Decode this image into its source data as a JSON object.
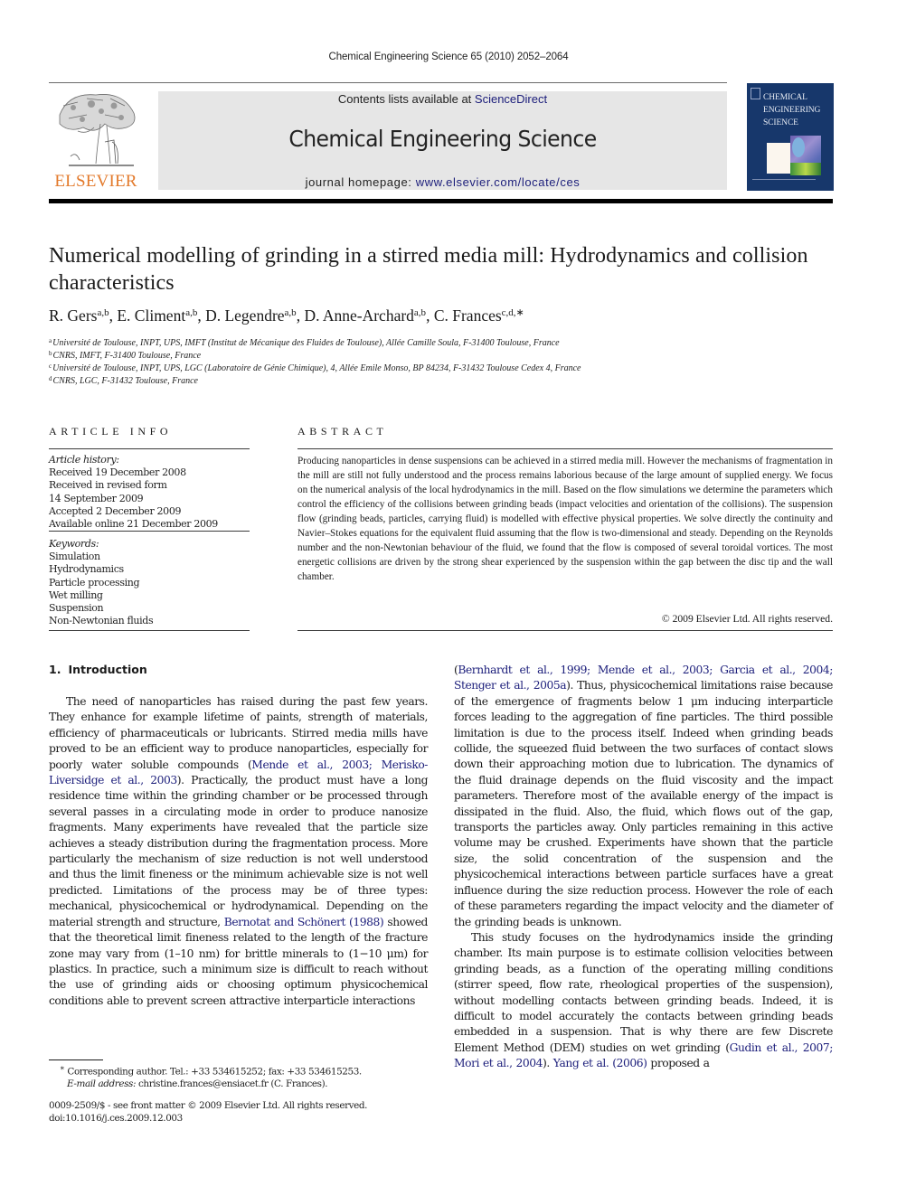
{
  "running_head": "Chemical Engineering Science 65 (2010) 2052–2064",
  "header": {
    "publisher_logo": "ELSEVIER",
    "contents_prefix": "Contents lists available at ",
    "contents_link": "ScienceDirect",
    "journal_title": "Chemical Engineering Science",
    "homepage_prefix": "journal homepage: ",
    "homepage_link": "www.elsevier.com/locate/ces",
    "cover_title_lines": [
      "CHEMICAL",
      "ENGINEERING",
      "SCIENCE"
    ],
    "colors": {
      "publisher_orange": "#e37a2c",
      "link_blue": "#1b1d7a",
      "banner_gray": "#e6e6e6",
      "cover_blue": "#17376b"
    }
  },
  "article": {
    "title": "Numerical modelling of grinding in a stirred media mill: Hydrodynamics and collision characteristics",
    "authors": [
      {
        "name": "R. Gers",
        "sup": "a,b",
        "sep": ", "
      },
      {
        "name": "E. Climent",
        "sup": "a,b",
        "sep": ", "
      },
      {
        "name": "D. Legendre",
        "sup": "a,b",
        "sep": ", "
      },
      {
        "name": "D. Anne-Archard",
        "sup": "a,b",
        "sep": ", "
      },
      {
        "name": "C. Frances",
        "sup": "c,d,∗",
        "sep": ""
      }
    ],
    "affiliations": [
      {
        "mark": "a",
        "text": "Université de Toulouse, INPT, UPS, IMFT (Institut de Mécanique des Fluides de Toulouse), Allée Camille Soula, F-31400 Toulouse, France"
      },
      {
        "mark": "b",
        "text": "CNRS, IMFT, F-31400 Toulouse, France"
      },
      {
        "mark": "c",
        "text": "Université de Toulouse, INPT, UPS, LGC (Laboratoire de Génie Chimique), 4, Allée Emile Monso, BP 84234, F-31432 Toulouse Cedex 4, France"
      },
      {
        "mark": "d",
        "text": "CNRS, LGC, F-31432 Toulouse, France"
      }
    ]
  },
  "article_info": {
    "heading": "ARTICLE INFO",
    "history_label": "Article history:",
    "history": [
      "Received 19 December 2008",
      "Received in revised form",
      "14 September 2009",
      "Accepted 2 December 2009",
      "Available online 21 December 2009"
    ],
    "keywords_label": "Keywords:",
    "keywords": [
      "Simulation",
      "Hydrodynamics",
      "Particle processing",
      "Wet milling",
      "Suspension",
      "Non-Newtonian fluids"
    ]
  },
  "abstract": {
    "heading": "ABSTRACT",
    "text": "Producing nanoparticles in dense suspensions can be achieved in a stirred media mill. However the mechanisms of fragmentation in the mill are still not fully understood and the process remains laborious because of the large amount of supplied energy. We focus on the numerical analysis of the local hydrodynamics in the mill. Based on the flow simulations we determine the parameters which control the efficiency of the collisions between grinding beads (impact velocities and orientation of the collisions). The suspension flow (grinding beads, particles, carrying fluid) is modelled with effective physical properties. We solve directly the continuity and Navier–Stokes equations for the equivalent fluid assuming that the flow is two-dimensional and steady. Depending on the Reynolds number and the non-Newtonian behaviour of the fluid, we found that the flow is composed of several toroidal vortices. The most energetic collisions are driven by the strong shear experienced by the suspension within the gap between the disc tip and the wall chamber.",
    "copyright": "© 2009 Elsevier Ltd. All rights reserved."
  },
  "introduction": {
    "number": "1.",
    "title": "Introduction",
    "left": {
      "t1": "The need of nanoparticles has raised during the past few years. They enhance for example lifetime of paints, strength of materials, efficiency of pharmaceuticals or lubricants. Stirred media mills have proved to be an efficient way to produce nanoparticles, especially for poorly water soluble compounds (",
      "ref1": "Mende et al., 2003; Merisko-Liversidge et al., 2003",
      "t2": "). Practically, the product must have a long residence time within the grinding chamber or be processed through several passes in a circulating mode in order to produce nanosize fragments. Many experiments have revealed that the particle size achieves a steady distribution during the fragmentation process. More particularly the mechanism of size reduction is not well understood and thus the limit fineness or the minimum achievable size is not well predicted. Limitations of the process may be of three types: mechanical, physicochemical or hydrodynamical. Depending on the material strength and structure, ",
      "ref2": "Bernotat and Schönert (1988)",
      "t3": " showed that the theoretical limit fineness related to the length of the fracture zone may vary from (1–10 nm) for brittle minerals to (1−10 μm) for plastics. In practice, such a minimum size is difficult to reach without the use of grinding aids or choosing optimum physicochemical conditions able to prevent screen attractive interparticle interactions"
    },
    "right": {
      "t0": "(",
      "ref1": "Bernhardt et al., 1999; Mende et al., 2003; Garcia et al., 2004; Stenger et al., 2005a",
      "t1": "). Thus, physicochemical limitations raise because of the emergence of fragments below 1 μm inducing interparticle forces leading to the aggregation of fine particles. The third possible limitation is due to the process itself. Indeed when grinding beads collide, the squeezed fluid between the two surfaces of contact slows down their approaching motion due to lubrication. The dynamics of the fluid drainage depends on the fluid viscosity and the impact parameters. Therefore most of the available energy of the impact is dissipated in the fluid. Also, the fluid, which flows out of the gap, transports the particles away. Only particles remaining in this active volume may be crushed. Experiments have shown that the particle size, the solid concentration of the suspension and the physicochemical interactions between particle surfaces have a great influence during the size reduction process. However the role of each of these parameters regarding the impact velocity and the diameter of the grinding beads is unknown.",
      "p2_t1": "This study focuses on the hydrodynamics inside the grinding chamber. Its main purpose is to estimate collision velocities between grinding beads, as a function of the operating milling conditions (stirrer speed, flow rate, rheological properties of the suspension), without modelling contacts between grinding beads. Indeed, it is difficult to model accurately the contacts between grinding beads embedded in a suspension. That is why there are few Discrete Element Method (DEM) studies on wet grinding (",
      "p2_ref1": "Gudin et al., 2007; Mori et al., 2004",
      "p2_t2": "). ",
      "p2_ref2": "Yang et al. (2006)",
      "p2_t3": " proposed a"
    }
  },
  "footnote": {
    "mark": "∗",
    "corresponding": " Corresponding author. Tel.: +33 534615252; fax: +33 534615253.",
    "email_label": "E-mail address:",
    "email": " christine.frances@ensiacet.fr (C. Frances)."
  },
  "front_matter": {
    "issn_line": "0009-2509/$ - see front matter © 2009 Elsevier Ltd. All rights reserved.",
    "doi": "doi:10.1016/j.ces.2009.12.003"
  }
}
